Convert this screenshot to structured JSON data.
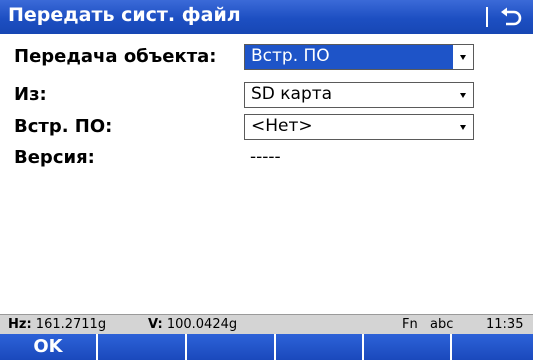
{
  "window": {
    "title": "Передать сист. файл"
  },
  "form": {
    "rows": [
      {
        "label": "Передача объекта:",
        "value": "Встр. ПО",
        "type": "dropdown",
        "selected": true
      },
      {
        "label": "Из:",
        "value": "SD карта",
        "type": "dropdown",
        "selected": false
      },
      {
        "label": "Встр. ПО:",
        "value": "<Нет>",
        "type": "dropdown",
        "selected": false
      },
      {
        "label": "Версия:",
        "value": "-----",
        "type": "text"
      }
    ]
  },
  "status": {
    "hz_label": "Hz:",
    "hz_value": "161.2711g",
    "v_label": "V:",
    "v_value": "100.0424g",
    "fn": "Fn",
    "input_mode": "abc",
    "time": "11:35"
  },
  "softkeys": [
    "OK",
    "",
    "",
    "",
    "",
    ""
  ],
  "colors": {
    "accent": "#1e54c8",
    "status_bg": "#d4d4d4"
  }
}
